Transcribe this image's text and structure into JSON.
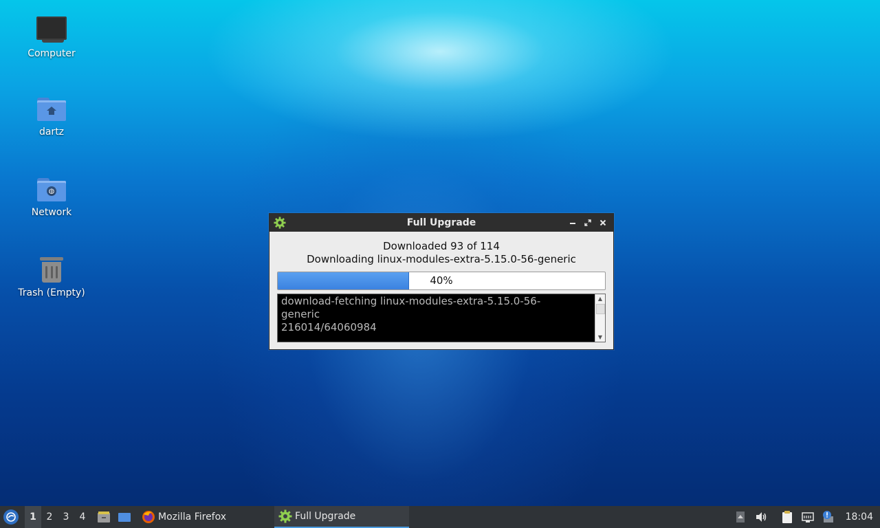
{
  "desktop": {
    "icons": [
      {
        "label": "Computer"
      },
      {
        "label": "dartz"
      },
      {
        "label": "Network"
      },
      {
        "label": "Trash (Empty)"
      }
    ]
  },
  "dialog": {
    "title": "Full Upgrade",
    "status_line1": "Downloaded 93 of 114",
    "status_line2": "Downloading linux-modules-extra-5.15.0-56-generic",
    "progress_percent": 40,
    "progress_label": "40%",
    "console_text": "download-fetching linux-modules-extra-5.15.0-56-\ngeneric\n216014/64060984",
    "controls": {
      "minimize": "minimize",
      "maximize": "maximize",
      "close": "close"
    }
  },
  "taskbar": {
    "workspaces": [
      "1",
      "2",
      "3",
      "4"
    ],
    "active_workspace": "1",
    "tasks": [
      {
        "label": "Mozilla Firefox",
        "icon": "firefox-icon"
      },
      {
        "label": "Full Upgrade",
        "icon": "gear-icon"
      }
    ],
    "clock": "18:04"
  },
  "colors": {
    "progress_fill": "#3b82e0",
    "titlebar": "#2e2e2e",
    "taskbar": "#2f3337"
  }
}
